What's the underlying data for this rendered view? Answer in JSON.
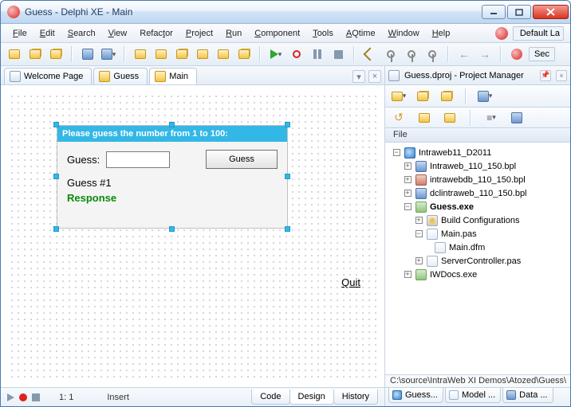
{
  "window": {
    "title": "Guess - Delphi XE - Main"
  },
  "menu": [
    "File",
    "Edit",
    "Search",
    "View",
    "Refactor",
    "Project",
    "Run",
    "Component",
    "Tools",
    "AQtime",
    "Window",
    "Help"
  ],
  "layout_label": "Default La",
  "toolbar_right_chip": "Sec",
  "tabs": {
    "items": [
      {
        "label": "Welcome Page"
      },
      {
        "label": "Guess"
      },
      {
        "label": "Main"
      }
    ]
  },
  "designer": {
    "panel_title": "Please guess the number from 1 to 100:",
    "guess_label": "Guess:",
    "guess_button": "Guess",
    "guess_count": "Guess #1",
    "response": "Response",
    "quit": "Quit"
  },
  "status": {
    "pos": "1:  1",
    "mode": "Insert",
    "views": [
      "Code",
      "Design",
      "History"
    ]
  },
  "project_panel": {
    "title": "Guess.dproj - Project Manager",
    "file_hdr": "File",
    "tree": {
      "root": "Intraweb11_D2011",
      "bpl1": "Intraweb_110_150.bpl",
      "bpl2": "intrawebdb_110_150.bpl",
      "bpl3": "dclintraweb_110_150.bpl",
      "exe": "Guess.exe",
      "build": "Build Configurations",
      "mainpas": "Main.pas",
      "maindfm": "Main.dfm",
      "servctrl": "ServerController.pas",
      "iwdocs": "IWDocs.exe"
    },
    "path": "C:\\source\\IntraWeb XI Demos\\Atozed\\Guess\\",
    "bottom_tabs": [
      "Guess...",
      "Model ...",
      "Data ..."
    ]
  }
}
